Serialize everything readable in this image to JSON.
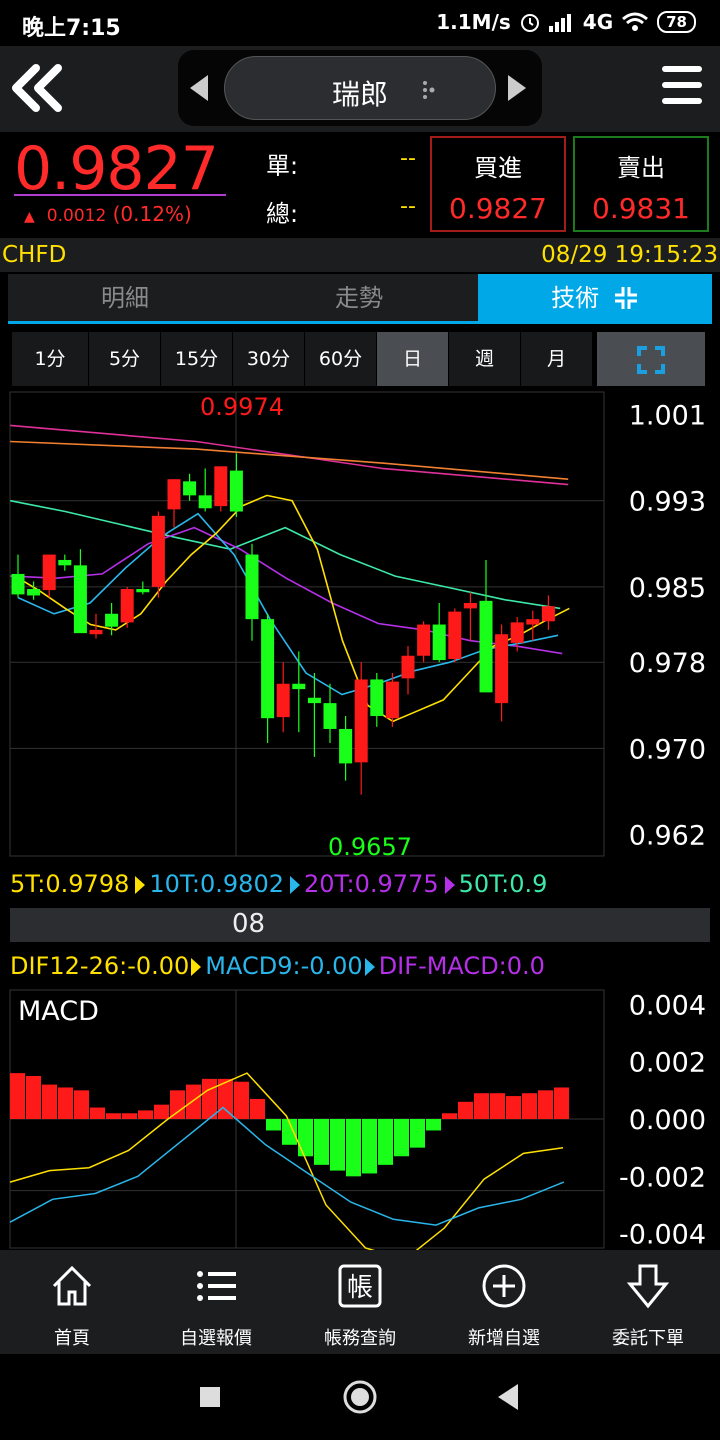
{
  "status_bar": {
    "time": "晚上7:15",
    "speed": "1.1M/s",
    "network": "4G",
    "battery": "78"
  },
  "nav": {
    "title": "瑞郎"
  },
  "quote": {
    "price": "0.9827",
    "change": "0.0012",
    "change_pct": "(0.12%)",
    "single_label": "單:",
    "single_value": "--",
    "total_label": "總:",
    "total_value": "--",
    "buy_label": "買進",
    "buy_price": "0.9827",
    "sell_label": "賣出",
    "sell_price": "0.9831"
  },
  "info": {
    "symbol": "CHFD",
    "datetime": "08/29 19:15:23"
  },
  "tabs": [
    {
      "label": "明細"
    },
    {
      "label": "走勢"
    },
    {
      "label": "技術"
    }
  ],
  "periods": [
    {
      "label": "1分"
    },
    {
      "label": "5分"
    },
    {
      "label": "15分"
    },
    {
      "label": "30分"
    },
    {
      "label": "60分"
    },
    {
      "label": "日"
    },
    {
      "label": "週"
    },
    {
      "label": "月"
    }
  ],
  "ma_legend": [
    {
      "label": "5T:0.9798",
      "color": "#ffe000"
    },
    {
      "label": "10T:0.9802",
      "color": "#29b6ea"
    },
    {
      "label": "20T:0.9775",
      "color": "#b530e8"
    },
    {
      "label": "50T:0.9",
      "color": "#3de8a8"
    }
  ],
  "date_marker": "08",
  "macd_legend": [
    {
      "label": "DIF12-26:-0.00",
      "color": "#ffe000"
    },
    {
      "label": "MACD9:-0.00",
      "color": "#29b6ea"
    },
    {
      "label": "DIF-MACD:0.0",
      "color": "#b530e8"
    }
  ],
  "colors": {
    "up": "#ff1a1a",
    "down": "#1aff1a",
    "accent": "#00a8e8",
    "yellow": "#ffe000"
  },
  "chart_data": [
    {
      "type": "candlestick",
      "y_ticks": [
        "1.001",
        "0.993",
        "0.985",
        "0.978",
        "0.970",
        "0.962"
      ],
      "ylim": [
        0.96,
        1.0031
      ],
      "annotations": [
        {
          "text": "0.9974"
        },
        {
          "text": "0.9657"
        }
      ],
      "candles": [
        {
          "o": 0.9862,
          "h": 0.988,
          "l": 0.984,
          "c": 0.9843
        },
        {
          "o": 0.9848,
          "h": 0.9855,
          "l": 0.9838,
          "c": 0.9842
        },
        {
          "o": 0.9847,
          "h": 0.987,
          "l": 0.984,
          "c": 0.988
        },
        {
          "o": 0.9875,
          "h": 0.988,
          "l": 0.9865,
          "c": 0.987
        },
        {
          "o": 0.987,
          "h": 0.9885,
          "l": 0.981,
          "c": 0.9807
        },
        {
          "o": 0.9806,
          "h": 0.9825,
          "l": 0.9802,
          "c": 0.981
        },
        {
          "o": 0.9825,
          "h": 0.9835,
          "l": 0.9805,
          "c": 0.9813
        },
        {
          "o": 0.9817,
          "h": 0.985,
          "l": 0.9812,
          "c": 0.9848
        },
        {
          "o": 0.9848,
          "h": 0.9855,
          "l": 0.9843,
          "c": 0.9845
        },
        {
          "o": 0.985,
          "h": 0.992,
          "l": 0.984,
          "c": 0.9916
        },
        {
          "o": 0.9922,
          "h": 0.995,
          "l": 0.9905,
          "c": 0.995
        },
        {
          "o": 0.9948,
          "h": 0.9955,
          "l": 0.993,
          "c": 0.9935
        },
        {
          "o": 0.9935,
          "h": 0.996,
          "l": 0.992,
          "c": 0.9923
        },
        {
          "o": 0.9925,
          "h": 0.996,
          "l": 0.992,
          "c": 0.9962
        },
        {
          "o": 0.9958,
          "h": 0.9974,
          "l": 0.9915,
          "c": 0.992
        },
        {
          "o": 0.988,
          "h": 0.989,
          "l": 0.98,
          "c": 0.982
        },
        {
          "o": 0.982,
          "h": 0.9825,
          "l": 0.9705,
          "c": 0.9728
        },
        {
          "o": 0.9729,
          "h": 0.978,
          "l": 0.9715,
          "c": 0.976
        },
        {
          "o": 0.976,
          "h": 0.979,
          "l": 0.9715,
          "c": 0.9755
        },
        {
          "o": 0.9747,
          "h": 0.977,
          "l": 0.9692,
          "c": 0.9742
        },
        {
          "o": 0.9742,
          "h": 0.976,
          "l": 0.9705,
          "c": 0.9718
        },
        {
          "o": 0.9718,
          "h": 0.973,
          "l": 0.967,
          "c": 0.9686
        },
        {
          "o": 0.9687,
          "h": 0.978,
          "l": 0.9657,
          "c": 0.9764
        },
        {
          "o": 0.9764,
          "h": 0.977,
          "l": 0.972,
          "c": 0.973
        },
        {
          "o": 0.9728,
          "h": 0.977,
          "l": 0.972,
          "c": 0.9762
        },
        {
          "o": 0.9765,
          "h": 0.9795,
          "l": 0.975,
          "c": 0.9786
        },
        {
          "o": 0.9786,
          "h": 0.9818,
          "l": 0.978,
          "c": 0.9815
        },
        {
          "o": 0.9815,
          "h": 0.9835,
          "l": 0.978,
          "c": 0.9782
        },
        {
          "o": 0.9783,
          "h": 0.983,
          "l": 0.978,
          "c": 0.9827
        },
        {
          "o": 0.983,
          "h": 0.9845,
          "l": 0.98,
          "c": 0.9835
        },
        {
          "o": 0.9837,
          "h": 0.9875,
          "l": 0.978,
          "c": 0.9752
        },
        {
          "o": 0.9742,
          "h": 0.9815,
          "l": 0.9725,
          "c": 0.9806
        },
        {
          "o": 0.9798,
          "h": 0.9822,
          "l": 0.979,
          "c": 0.9817
        },
        {
          "o": 0.9815,
          "h": 0.9828,
          "l": 0.98,
          "c": 0.982
        },
        {
          "o": 0.9818,
          "h": 0.9842,
          "l": 0.981,
          "c": 0.9832
        }
      ],
      "ma5": [
        0.986,
        0.9846,
        0.983,
        0.9815,
        0.981,
        0.9825,
        0.9855,
        0.988,
        0.99,
        0.9925,
        0.9935,
        0.993,
        0.9885,
        0.98,
        0.974,
        0.9725,
        0.9735,
        0.9745,
        0.977,
        0.9795,
        0.9805,
        0.9818,
        0.983
      ],
      "ma10": [
        0.984,
        0.9825,
        0.9835,
        0.9868,
        0.9897,
        0.9918,
        0.988,
        0.982,
        0.977,
        0.975,
        0.976,
        0.9772,
        0.978,
        0.9792,
        0.9798,
        0.9805
      ],
      "ma20": [
        0.986,
        0.9858,
        0.9862,
        0.989,
        0.9905,
        0.9885,
        0.9858,
        0.9835,
        0.9816,
        0.981,
        0.98,
        0.9795,
        0.9788
      ],
      "ma50": [
        0.993,
        0.992,
        0.9908,
        0.9896,
        0.9885,
        0.9905,
        0.988,
        0.986,
        0.9849,
        0.9838,
        0.983
      ],
      "ma_long_a": [
        1.0,
        0.9985,
        0.996,
        0.9945
      ],
      "ma_long_b": [
        0.9985,
        0.9978,
        0.9965,
        0.995
      ]
    },
    {
      "type": "macd",
      "title": "MACD",
      "y_ticks": [
        "0.004",
        "0.002",
        "0.000",
        "-0.002",
        "-0.004"
      ],
      "ylim": [
        -0.0045,
        0.0045
      ],
      "histogram": [
        0.0016,
        0.0015,
        0.0012,
        0.0011,
        0.001,
        0.0004,
        0.0002,
        0.0002,
        0.0003,
        0.0005,
        0.001,
        0.0012,
        0.0014,
        0.0014,
        0.0013,
        0.0007,
        -0.0004,
        -0.0009,
        -0.0013,
        -0.0016,
        -0.0018,
        -0.002,
        -0.0019,
        -0.0016,
        -0.0013,
        -0.001,
        -0.0004,
        0.0002,
        0.0006,
        0.0009,
        0.0009,
        0.0008,
        0.0009,
        0.001,
        0.0011
      ],
      "dif": [
        -0.0022,
        -0.0018,
        -0.0017,
        -0.0011,
        0.0,
        0.001,
        0.0016,
        0.0001,
        -0.003,
        -0.0045,
        -0.0049,
        -0.0038,
        -0.0021,
        -0.0012,
        -0.001
      ],
      "macd9": [
        -0.0036,
        -0.0028,
        -0.0026,
        -0.002,
        -0.0008,
        0.0004,
        -0.0009,
        -0.0019,
        -0.0029,
        -0.0035,
        -0.0037,
        -0.0031,
        -0.0028,
        -0.0022
      ]
    }
  ],
  "bottom_nav": [
    {
      "label": "首頁",
      "icon": "home-icon"
    },
    {
      "label": "自選報價",
      "icon": "list-icon"
    },
    {
      "label": "帳務查詢",
      "icon": "account-icon"
    },
    {
      "label": "新增自選",
      "icon": "add-icon"
    },
    {
      "label": "委託下單",
      "icon": "order-icon"
    }
  ]
}
